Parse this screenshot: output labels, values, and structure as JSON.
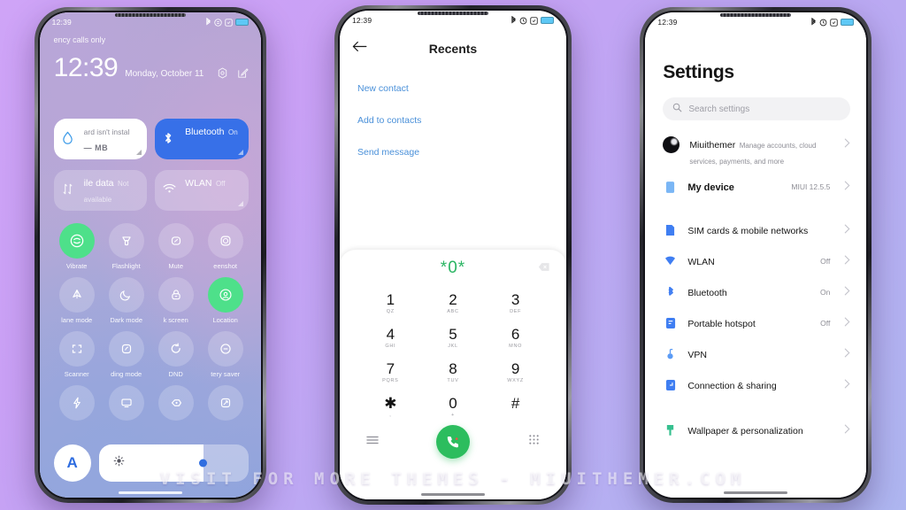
{
  "background": {
    "color_start": "#cfa4f7",
    "color_end": "#aeb6f0"
  },
  "watermark": {
    "text": "VISIT FOR MORE THEMES - MIUITHEMER.COM"
  },
  "phone_lockscreen": {
    "statusbar": {
      "clock": "12:39",
      "icons": [
        "bluetooth-icon",
        "mute-icon",
        "square-icon",
        "battery-icon"
      ]
    },
    "carrier": "ency calls only",
    "clock": "12:39",
    "date": "Monday, October 11",
    "actions": [
      {
        "name": "settings-gear-icon"
      },
      {
        "name": "edit-icon"
      }
    ],
    "big_tiles": [
      {
        "name": "sim-data-tile",
        "title": "ard isn't instal",
        "sub": "— MB",
        "style": "white",
        "icon": "water-drop-icon"
      },
      {
        "name": "bluetooth-tile",
        "title": "Bluetooth",
        "sub": "On",
        "style": "blue",
        "icon": "bluetooth-icon"
      },
      {
        "name": "mobile-data-tile",
        "title": "ile data",
        "sub": "Not available",
        "style": "glass",
        "icon": "data-arrows-icon"
      },
      {
        "name": "wlan-tile",
        "title": "WLAN",
        "sub": "Off",
        "style": "glass",
        "icon": "wifi-icon"
      }
    ],
    "toggles": [
      {
        "label": "Vibrate",
        "icon": "vibrate-icon",
        "active": true
      },
      {
        "label": "Flashlight",
        "icon": "flashlight-icon",
        "active": false
      },
      {
        "label": "Mute",
        "icon": "mute-icon",
        "active": false
      },
      {
        "label": "eenshot",
        "icon": "screenshot-icon",
        "active": false
      },
      {
        "label": "lane mode",
        "icon": "airplane-icon",
        "active": false
      },
      {
        "label": "Dark mode",
        "icon": "dark-mode-icon",
        "active": false
      },
      {
        "label": "k screen",
        "icon": "lock-screen-icon",
        "active": false
      },
      {
        "label": "Location",
        "icon": "location-icon",
        "active": true
      },
      {
        "label": "Scanner",
        "icon": "scanner-icon",
        "active": false
      },
      {
        "label": "ding mode",
        "icon": "reading-mode-icon",
        "active": false
      },
      {
        "label": "DND",
        "icon": "dnd-icon",
        "active": false
      },
      {
        "label": "tery saver",
        "icon": "battery-saver-icon",
        "active": false
      },
      {
        "label": "",
        "icon": "bolt-icon",
        "active": false
      },
      {
        "label": "",
        "icon": "cast-icon",
        "active": false
      },
      {
        "label": "",
        "icon": "tag-icon",
        "active": false
      },
      {
        "label": "",
        "icon": "rotate-icon",
        "active": false
      }
    ],
    "brightness": {
      "auto_label": "A",
      "value_percent": 70,
      "icon": "sun-icon"
    }
  },
  "phone_dialer": {
    "statusbar": {
      "clock": "12:39"
    },
    "back_icon": "back-arrow-icon",
    "title": "Recents",
    "links": [
      {
        "label": "New contact"
      },
      {
        "label": "Add to contacts"
      },
      {
        "label": "Send message"
      }
    ],
    "dialpad": {
      "entered_number": "*0*",
      "backspace_icon": "backspace-icon",
      "keys": [
        {
          "num": "1",
          "sub": "QZ"
        },
        {
          "num": "2",
          "sub": "ABC"
        },
        {
          "num": "3",
          "sub": "DEF"
        },
        {
          "num": "4",
          "sub": "GHI"
        },
        {
          "num": "5",
          "sub": "JKL"
        },
        {
          "num": "6",
          "sub": "MNO"
        },
        {
          "num": "7",
          "sub": "PQRS"
        },
        {
          "num": "8",
          "sub": "TUV"
        },
        {
          "num": "9",
          "sub": "WXYZ"
        },
        {
          "num": "✱",
          "sub": ","
        },
        {
          "num": "0",
          "sub": "+"
        },
        {
          "num": "#",
          "sub": ""
        }
      ],
      "menu_icon": "menu-icon",
      "call_icon": "call-icon",
      "keypad_icon": "keypad-icon"
    }
  },
  "phone_settings": {
    "statusbar": {
      "clock": "12:39"
    },
    "title": "Settings",
    "search": {
      "placeholder": "Search settings",
      "icon": "search-icon"
    },
    "account": {
      "name": "Miuithemer",
      "desc": "Manage accounts, cloud services, payments, and more"
    },
    "device": {
      "name": "My device",
      "value": "MIUI 12.5.5",
      "icon": "device-icon"
    },
    "items": [
      {
        "label": "SIM cards & mobile networks",
        "value": "",
        "icon": "sim-icon"
      },
      {
        "label": "WLAN",
        "value": "Off",
        "icon": "wifi-icon"
      },
      {
        "label": "Bluetooth",
        "value": "On",
        "icon": "bluetooth-icon"
      },
      {
        "label": "Portable hotspot",
        "value": "Off",
        "icon": "hotspot-icon"
      },
      {
        "label": "VPN",
        "value": "",
        "icon": "vpn-icon"
      },
      {
        "label": "Connection & sharing",
        "value": "",
        "icon": "connection-icon"
      }
    ],
    "items2": [
      {
        "label": "Wallpaper & personalization",
        "value": "",
        "icon": "wallpaper-icon"
      }
    ]
  }
}
